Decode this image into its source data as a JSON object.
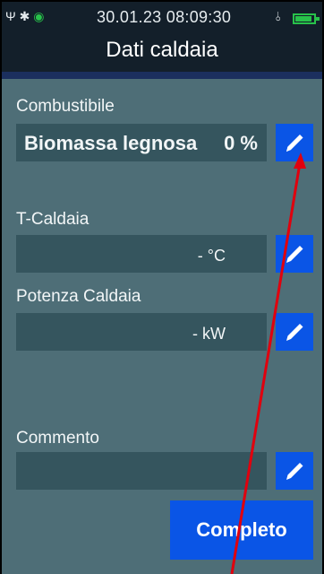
{
  "status_bar": {
    "left_icons": "Ψ ✱",
    "wifi": "◉",
    "datetime": "30.01.23 08:09:30",
    "plug_icon": "⫰",
    "battery_level": 0.9
  },
  "header": {
    "title": "Dati caldaia"
  },
  "fuel": {
    "label": "Combustibile",
    "value": "Biomassa legnosa",
    "percent": "0 %"
  },
  "boiler_temp": {
    "label": "T-Caldaia",
    "value": "- °C"
  },
  "boiler_power": {
    "label": "Potenza Caldaia",
    "value": "- kW"
  },
  "comment": {
    "label": "Commento",
    "value": ""
  },
  "complete_button": {
    "label": "Completo"
  },
  "colors": {
    "accent": "#0a55e6",
    "annotation_arrow": "#e0000e"
  }
}
